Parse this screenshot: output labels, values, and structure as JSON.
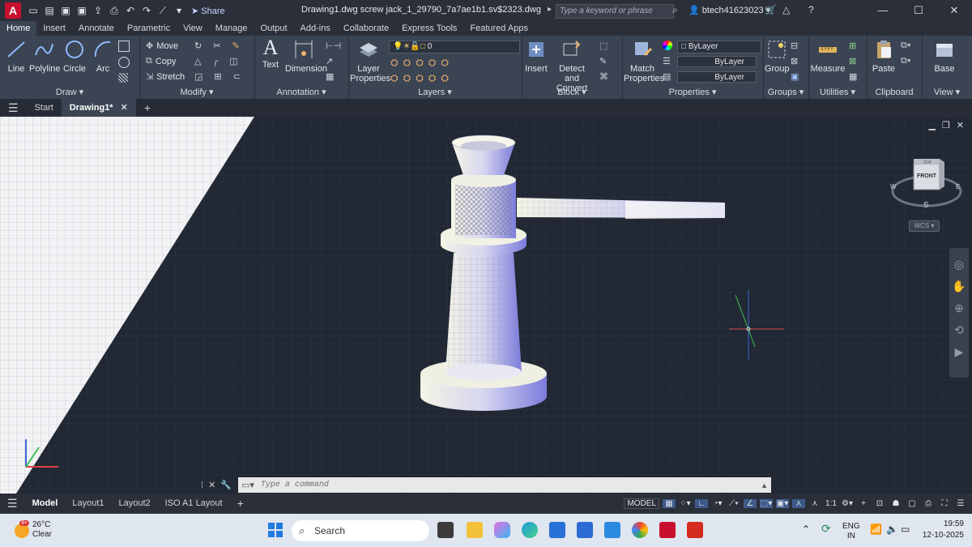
{
  "app": {
    "title": "Drawing1.dwg screw jack_1_29790_7a7ae1b1.sv$2323.dwg",
    "share_label": "Share",
    "search_placeholder": "Type a keyword or phrase",
    "username": "btech41623023"
  },
  "ribbon_tabs": [
    "Home",
    "Insert",
    "Annotate",
    "Parametric",
    "View",
    "Manage",
    "Output",
    "Add-ins",
    "Collaborate",
    "Express Tools",
    "Featured Apps"
  ],
  "draw": {
    "line": "Line",
    "polyline": "Polyline",
    "circle": "Circle",
    "arc": "Arc",
    "label": "Draw"
  },
  "modify": {
    "move": "Move",
    "copy": "Copy",
    "stretch": "Stretch",
    "label": "Modify"
  },
  "annotation": {
    "text": "Text",
    "dimension": "Dimension",
    "label": "Annotation"
  },
  "layers": {
    "properties": "Layer Properties",
    "current": "0",
    "label": "Layers"
  },
  "block": {
    "insert": "Insert",
    "detect": "Detect and Convert",
    "label": "Block"
  },
  "properties": {
    "match": "Match Properties",
    "color": "ByLayer",
    "linetype": "ByLayer",
    "lineweight": "ByLayer",
    "label": "Properties"
  },
  "groups": {
    "group": "Group",
    "label": "Groups"
  },
  "utilities": {
    "measure": "Measure",
    "label": "Utilities"
  },
  "clipboard": {
    "paste": "Paste",
    "label": "Clipboard"
  },
  "view": {
    "base": "Base",
    "label": "View"
  },
  "doc_tabs": {
    "start": "Start",
    "drawing": "Drawing1*"
  },
  "viewcube": {
    "top": "TOP",
    "front": "FRONT",
    "s": "S",
    "w": "W",
    "e": "E",
    "wcs": "WCS"
  },
  "command": {
    "placeholder": "Type a command"
  },
  "layouts": [
    "Model",
    "Layout1",
    "Layout2",
    "ISO A1 Layout"
  ],
  "status": {
    "model": "MODEL",
    "scale": "1:1"
  },
  "taskbar": {
    "temp": "26°C",
    "weather": "Clear",
    "badge": "9+",
    "search": "Search",
    "lang1": "ENG",
    "lang2": "IN",
    "time": "19:59",
    "date": "12-10-2025"
  }
}
